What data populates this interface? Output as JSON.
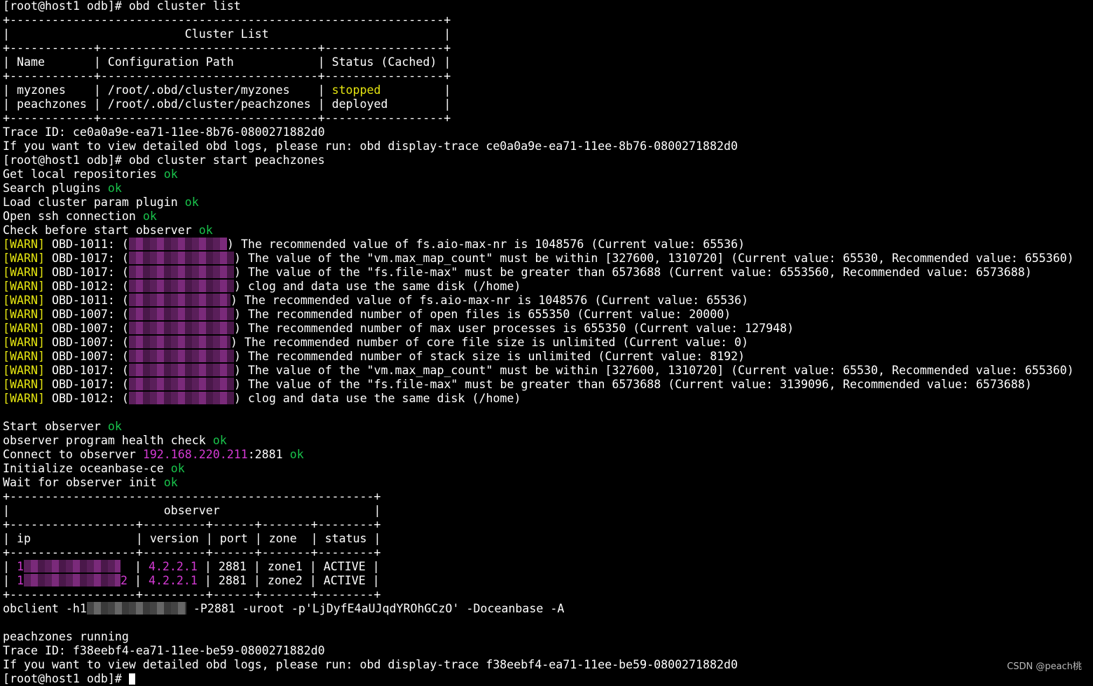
{
  "cluster_list_cmd": "[root@host1 odb]# obd cluster list",
  "cluster_table": {
    "title": "Cluster List",
    "headers": [
      "Name",
      "Configuration Path",
      "Status (Cached)"
    ],
    "rows": [
      {
        "name": "myzones",
        "path": "/root/.obd/cluster/myzones",
        "status": "stopped"
      },
      {
        "name": "peachzones",
        "path": "/root/.obd/cluster/peachzones",
        "status": "deployed"
      }
    ]
  },
  "trace1": {
    "id_line": "Trace ID: ce0a0a9e-ea71-11ee-8b76-0800271882d0",
    "hint": "If you want to view detailed obd logs, please run: obd display-trace ce0a0a9e-ea71-11ee-8b76-0800271882d0"
  },
  "start_cmd": "[root@host1 odb]# obd cluster start peachzones",
  "ok_label": "ok",
  "steps_pre": [
    "Get local repositories",
    "Search plugins",
    "Load cluster param plugin",
    "Open ssh connection",
    "Check before start observer"
  ],
  "warn_tag": "[WARN]",
  "warnings": [
    {
      "code": "OBD-1011:",
      "msg": "The recommended value of fs.aio-max-nr is 1048576 (Current value: 65536)"
    },
    {
      "code": "OBD-1017:",
      "msg": "The value of the \"vm.max_map_count\" must be within [327600, 1310720] (Current value: 65530, Recommended value: 655360)"
    },
    {
      "code": "OBD-1017:",
      "msg": "The value of the \"fs.file-max\" must be greater than 6573688 (Current value: 6553560, Recommended value: 6573688)"
    },
    {
      "code": "OBD-1012:",
      "msg": "clog and data use the same disk (/home)"
    },
    {
      "code": "OBD-1011:",
      "msg": "The recommended value of fs.aio-max-nr is 1048576 (Current value: 65536)"
    },
    {
      "code": "OBD-1007:",
      "msg": "The recommended number of open files is 655350 (Current value: 20000)"
    },
    {
      "code": "OBD-1007:",
      "msg": "The recommended number of max user processes is 655350 (Current value: 127948)"
    },
    {
      "code": "OBD-1007:",
      "msg": "The recommended number of core file size is unlimited (Current value: 0)"
    },
    {
      "code": "OBD-1007:",
      "msg": "The recommended number of stack size is unlimited (Current value: 8192)"
    },
    {
      "code": "OBD-1017:",
      "msg": "The value of the \"vm.max_map_count\" must be within [327600, 1310720] (Current value: 65530, Recommended value: 655360)"
    },
    {
      "code": "OBD-1017:",
      "msg": "The value of the \"fs.file-max\" must be greater than 6573688 (Current value: 3139096, Recommended value: 6573688)"
    },
    {
      "code": "OBD-1012:",
      "msg": "clog and data use the same disk (/home)"
    }
  ],
  "steps_post": {
    "start_observer": "Start observer",
    "health_check": "observer program health check",
    "connect_prefix": "Connect to observer",
    "connect_ip": "192.168.220.211",
    "connect_port": ":2881",
    "init": "Initialize oceanbase-ce",
    "wait": "Wait for observer init"
  },
  "observer_table": {
    "title": "observer",
    "headers": [
      "ip",
      "version",
      "port",
      "zone",
      "status"
    ],
    "rows": [
      {
        "ip_start": "1",
        "ip_end": "",
        "version": "4.2.2.1",
        "port": "2881",
        "zone": "zone1",
        "status": "ACTIVE"
      },
      {
        "ip_start": "1",
        "ip_end": "2",
        "version": "4.2.2.1",
        "port": "2881",
        "zone": "zone2",
        "status": "ACTIVE"
      }
    ]
  },
  "obclient": {
    "prefix": "obclient -h1",
    "suffix": " -P2881 -uroot -p'LjDyfE4aUJqdYROhGCzO' -Doceanbase -A"
  },
  "running": "peachzones running",
  "trace2": {
    "id_line": "Trace ID: f38eebf4-ea71-11ee-be59-0800271882d0",
    "hint": "If you want to view detailed obd logs, please run: obd display-trace f38eebf4-ea71-11ee-be59-0800271882d0"
  },
  "final_prompt": "[root@host1 odb]# ",
  "watermark": "CSDN @peach桃",
  "colors": {
    "background": "#000000",
    "text": "#ffffff",
    "ok": "#19c34b",
    "warn": "#e5e510",
    "highlight": "#d43ad4"
  }
}
